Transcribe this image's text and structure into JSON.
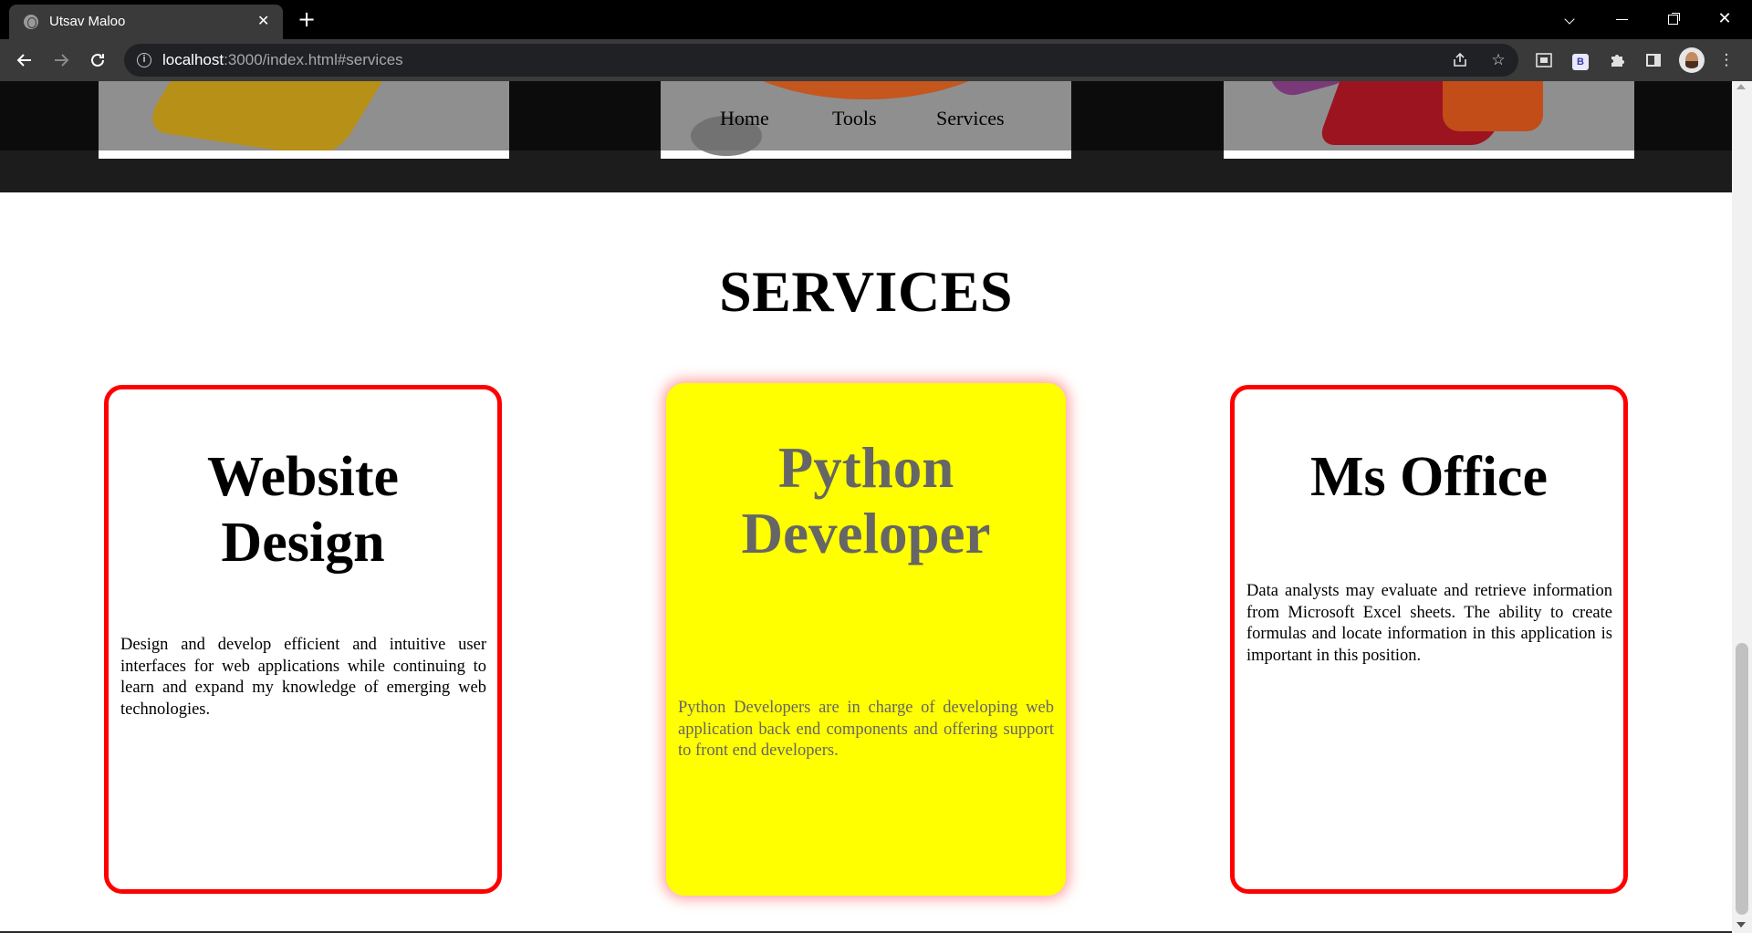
{
  "browser": {
    "tab_title": "Utsav Maloo",
    "tab_close": "✕",
    "new_tab": "+",
    "url_host": "localhost",
    "url_rest": ":3000/index.html#services",
    "info_glyph": "i",
    "ext_b": "B"
  },
  "nav": {
    "home": "Home",
    "tools": "Tools",
    "services": "Services"
  },
  "services": {
    "title": "SERVICES",
    "cards": [
      {
        "title_line1": "Website",
        "title_line2": "Design",
        "description": "Design and develop efficient and intuitive user interfaces for web applications while continuing to learn and expand my knowledge of emerging web technologies."
      },
      {
        "title_line1": "Python",
        "title_line2": "Developer",
        "description": "Python Developers are in charge of developing web application back end components and offering support to front end developers."
      },
      {
        "title_line1": "Ms Office",
        "title_line2": "",
        "description": "Data analysts may evaluate and retrieve information from Microsoft Excel sheets. The ability to create formulas and locate information in this application is important in this position."
      }
    ]
  },
  "colors": {
    "card_border": "#ff0000",
    "highlight_card_bg": "#ffff00",
    "highlight_text": "#666666",
    "tools_band": "#1c1c1c"
  },
  "icons": {
    "favicon": "globe-icon",
    "back": "arrow-left-icon",
    "forward": "arrow-right-icon",
    "reload": "reload-icon",
    "share": "share-icon",
    "bookmark": "star-icon",
    "extensions": "puzzle-icon",
    "menu": "more-vert-icon"
  }
}
